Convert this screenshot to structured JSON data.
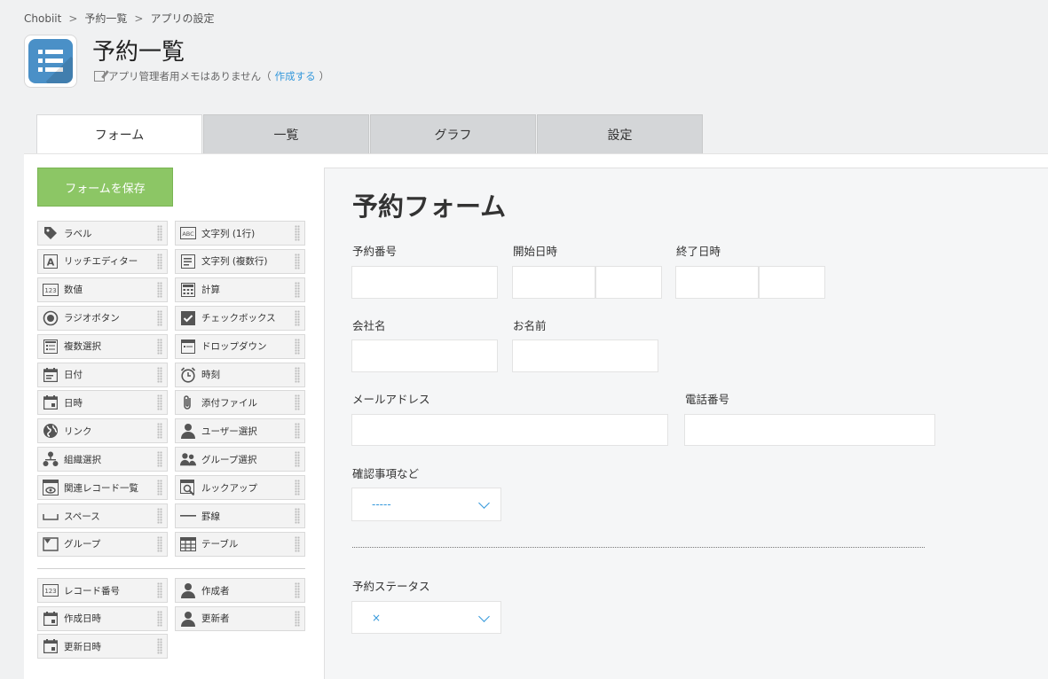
{
  "breadcrumb": {
    "items": [
      "Chobiit",
      "予約一覧",
      "アプリの設定"
    ],
    "separator": ">"
  },
  "header": {
    "title": "予約一覧",
    "memo_text": "アプリ管理者用メモはありません（",
    "memo_link": "作成する",
    "memo_close": "）"
  },
  "tabs": [
    "フォーム",
    "一覧",
    "グラフ",
    "設定"
  ],
  "sidebar": {
    "save_label": "フォームを保存",
    "fields": [
      {
        "label": "ラベル",
        "icon": "tag-icon"
      },
      {
        "label": "文字列 (1行)",
        "icon": "abc-icon"
      },
      {
        "label": "リッチエディター",
        "icon": "rich-text-icon"
      },
      {
        "label": "文字列 (複数行)",
        "icon": "multiline-icon"
      },
      {
        "label": "数値",
        "icon": "number-icon"
      },
      {
        "label": "計算",
        "icon": "calculator-icon"
      },
      {
        "label": "ラジオボタン",
        "icon": "radio-icon"
      },
      {
        "label": "チェックボックス",
        "icon": "checkbox-icon"
      },
      {
        "label": "複数選択",
        "icon": "multi-select-icon"
      },
      {
        "label": "ドロップダウン",
        "icon": "dropdown-icon"
      },
      {
        "label": "日付",
        "icon": "date-icon"
      },
      {
        "label": "時刻",
        "icon": "clock-icon"
      },
      {
        "label": "日時",
        "icon": "datetime-icon"
      },
      {
        "label": "添付ファイル",
        "icon": "paperclip-icon"
      },
      {
        "label": "リンク",
        "icon": "globe-icon"
      },
      {
        "label": "ユーザー選択",
        "icon": "user-icon"
      },
      {
        "label": "組織選択",
        "icon": "org-icon"
      },
      {
        "label": "グループ選択",
        "icon": "group-icon"
      },
      {
        "label": "関連レコード一覧",
        "icon": "related-records-icon"
      },
      {
        "label": "ルックアップ",
        "icon": "lookup-icon"
      },
      {
        "label": "スペース",
        "icon": "space-icon"
      },
      {
        "label": "罫線",
        "icon": "line-icon"
      },
      {
        "label": "グループ",
        "icon": "group-folder-icon"
      },
      {
        "label": "テーブル",
        "icon": "table-icon"
      }
    ],
    "system_fields": [
      {
        "label": "レコード番号",
        "icon": "number-icon"
      },
      {
        "label": "作成者",
        "icon": "user-icon"
      },
      {
        "label": "作成日時",
        "icon": "datetime-icon"
      },
      {
        "label": "更新者",
        "icon": "user-icon"
      },
      {
        "label": "更新日時",
        "icon": "datetime-icon"
      }
    ]
  },
  "form": {
    "title": "予約フォーム",
    "labels": {
      "reservation_number": "予約番号",
      "start_datetime": "開始日時",
      "end_datetime": "終了日時",
      "company_name": "会社名",
      "name": "お名前",
      "email": "メールアドレス",
      "phone": "電話番号",
      "confirmation": "確認事項など",
      "status": "予約ステータス"
    },
    "confirmation_value": "-----",
    "status_value": "×"
  },
  "colors": {
    "accent": "#3498db",
    "save_button": "#8cc665",
    "app_icon": "#4a90c7"
  }
}
